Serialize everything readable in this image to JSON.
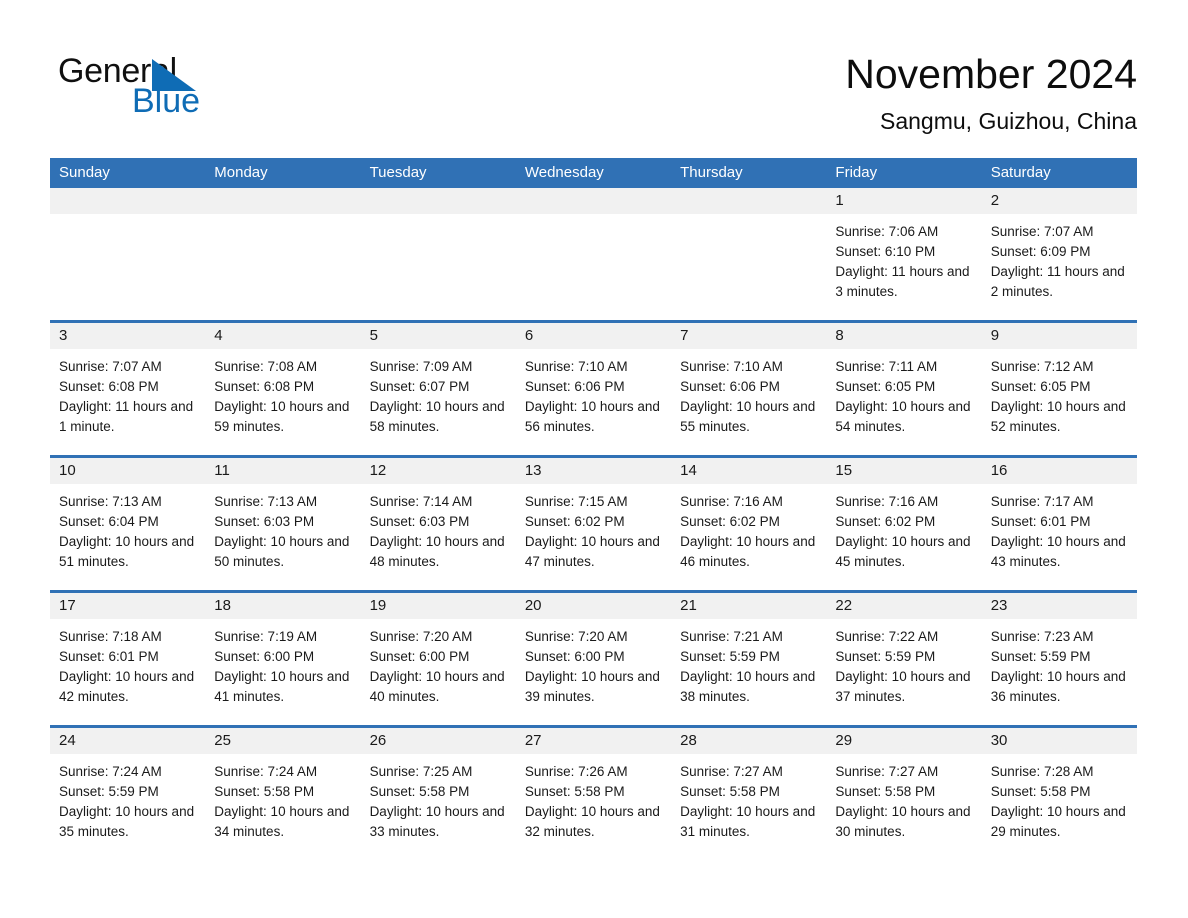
{
  "brand": {
    "word_one": "General",
    "word_two": "Blue",
    "triangle_icon": "triangle-logo-icon",
    "accent_color": "#0f6cb5"
  },
  "header": {
    "month_title": "November 2024",
    "location": "Sangmu, Guizhou, China"
  },
  "calendar": {
    "header_color": "#3071b5",
    "daynum_band_color": "#f1f1f1",
    "weekdays": [
      "Sunday",
      "Monday",
      "Tuesday",
      "Wednesday",
      "Thursday",
      "Friday",
      "Saturday"
    ],
    "weeks": [
      [
        {
          "day": "",
          "empty": true
        },
        {
          "day": "",
          "empty": true
        },
        {
          "day": "",
          "empty": true
        },
        {
          "day": "",
          "empty": true
        },
        {
          "day": "",
          "empty": true
        },
        {
          "day": "1",
          "sunrise": "Sunrise: 7:06 AM",
          "sunset": "Sunset: 6:10 PM",
          "daylight": "Daylight: 11 hours and 3 minutes."
        },
        {
          "day": "2",
          "sunrise": "Sunrise: 7:07 AM",
          "sunset": "Sunset: 6:09 PM",
          "daylight": "Daylight: 11 hours and 2 minutes."
        }
      ],
      [
        {
          "day": "3",
          "sunrise": "Sunrise: 7:07 AM",
          "sunset": "Sunset: 6:08 PM",
          "daylight": "Daylight: 11 hours and 1 minute."
        },
        {
          "day": "4",
          "sunrise": "Sunrise: 7:08 AM",
          "sunset": "Sunset: 6:08 PM",
          "daylight": "Daylight: 10 hours and 59 minutes."
        },
        {
          "day": "5",
          "sunrise": "Sunrise: 7:09 AM",
          "sunset": "Sunset: 6:07 PM",
          "daylight": "Daylight: 10 hours and 58 minutes."
        },
        {
          "day": "6",
          "sunrise": "Sunrise: 7:10 AM",
          "sunset": "Sunset: 6:06 PM",
          "daylight": "Daylight: 10 hours and 56 minutes."
        },
        {
          "day": "7",
          "sunrise": "Sunrise: 7:10 AM",
          "sunset": "Sunset: 6:06 PM",
          "daylight": "Daylight: 10 hours and 55 minutes."
        },
        {
          "day": "8",
          "sunrise": "Sunrise: 7:11 AM",
          "sunset": "Sunset: 6:05 PM",
          "daylight": "Daylight: 10 hours and 54 minutes."
        },
        {
          "day": "9",
          "sunrise": "Sunrise: 7:12 AM",
          "sunset": "Sunset: 6:05 PM",
          "daylight": "Daylight: 10 hours and 52 minutes."
        }
      ],
      [
        {
          "day": "10",
          "sunrise": "Sunrise: 7:13 AM",
          "sunset": "Sunset: 6:04 PM",
          "daylight": "Daylight: 10 hours and 51 minutes."
        },
        {
          "day": "11",
          "sunrise": "Sunrise: 7:13 AM",
          "sunset": "Sunset: 6:03 PM",
          "daylight": "Daylight: 10 hours and 50 minutes."
        },
        {
          "day": "12",
          "sunrise": "Sunrise: 7:14 AM",
          "sunset": "Sunset: 6:03 PM",
          "daylight": "Daylight: 10 hours and 48 minutes."
        },
        {
          "day": "13",
          "sunrise": "Sunrise: 7:15 AM",
          "sunset": "Sunset: 6:02 PM",
          "daylight": "Daylight: 10 hours and 47 minutes."
        },
        {
          "day": "14",
          "sunrise": "Sunrise: 7:16 AM",
          "sunset": "Sunset: 6:02 PM",
          "daylight": "Daylight: 10 hours and 46 minutes."
        },
        {
          "day": "15",
          "sunrise": "Sunrise: 7:16 AM",
          "sunset": "Sunset: 6:02 PM",
          "daylight": "Daylight: 10 hours and 45 minutes."
        },
        {
          "day": "16",
          "sunrise": "Sunrise: 7:17 AM",
          "sunset": "Sunset: 6:01 PM",
          "daylight": "Daylight: 10 hours and 43 minutes."
        }
      ],
      [
        {
          "day": "17",
          "sunrise": "Sunrise: 7:18 AM",
          "sunset": "Sunset: 6:01 PM",
          "daylight": "Daylight: 10 hours and 42 minutes."
        },
        {
          "day": "18",
          "sunrise": "Sunrise: 7:19 AM",
          "sunset": "Sunset: 6:00 PM",
          "daylight": "Daylight: 10 hours and 41 minutes."
        },
        {
          "day": "19",
          "sunrise": "Sunrise: 7:20 AM",
          "sunset": "Sunset: 6:00 PM",
          "daylight": "Daylight: 10 hours and 40 minutes."
        },
        {
          "day": "20",
          "sunrise": "Sunrise: 7:20 AM",
          "sunset": "Sunset: 6:00 PM",
          "daylight": "Daylight: 10 hours and 39 minutes."
        },
        {
          "day": "21",
          "sunrise": "Sunrise: 7:21 AM",
          "sunset": "Sunset: 5:59 PM",
          "daylight": "Daylight: 10 hours and 38 minutes."
        },
        {
          "day": "22",
          "sunrise": "Sunrise: 7:22 AM",
          "sunset": "Sunset: 5:59 PM",
          "daylight": "Daylight: 10 hours and 37 minutes."
        },
        {
          "day": "23",
          "sunrise": "Sunrise: 7:23 AM",
          "sunset": "Sunset: 5:59 PM",
          "daylight": "Daylight: 10 hours and 36 minutes."
        }
      ],
      [
        {
          "day": "24",
          "sunrise": "Sunrise: 7:24 AM",
          "sunset": "Sunset: 5:59 PM",
          "daylight": "Daylight: 10 hours and 35 minutes."
        },
        {
          "day": "25",
          "sunrise": "Sunrise: 7:24 AM",
          "sunset": "Sunset: 5:58 PM",
          "daylight": "Daylight: 10 hours and 34 minutes."
        },
        {
          "day": "26",
          "sunrise": "Sunrise: 7:25 AM",
          "sunset": "Sunset: 5:58 PM",
          "daylight": "Daylight: 10 hours and 33 minutes."
        },
        {
          "day": "27",
          "sunrise": "Sunrise: 7:26 AM",
          "sunset": "Sunset: 5:58 PM",
          "daylight": "Daylight: 10 hours and 32 minutes."
        },
        {
          "day": "28",
          "sunrise": "Sunrise: 7:27 AM",
          "sunset": "Sunset: 5:58 PM",
          "daylight": "Daylight: 10 hours and 31 minutes."
        },
        {
          "day": "29",
          "sunrise": "Sunrise: 7:27 AM",
          "sunset": "Sunset: 5:58 PM",
          "daylight": "Daylight: 10 hours and 30 minutes."
        },
        {
          "day": "30",
          "sunrise": "Sunrise: 7:28 AM",
          "sunset": "Sunset: 5:58 PM",
          "daylight": "Daylight: 10 hours and 29 minutes."
        }
      ]
    ]
  }
}
